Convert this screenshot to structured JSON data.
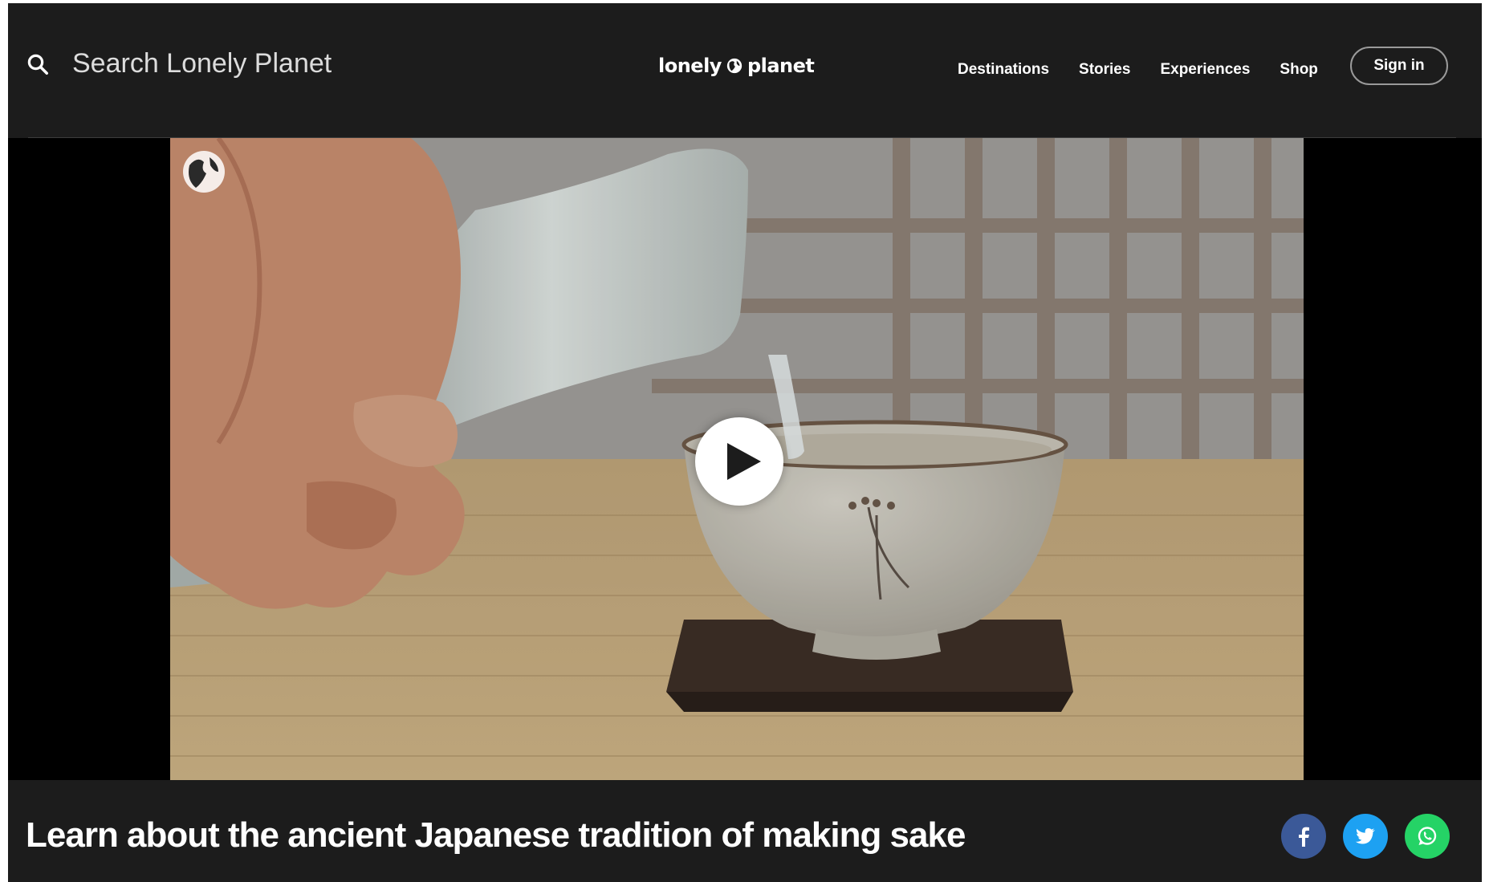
{
  "header": {
    "search_placeholder": "Search Lonely Planet",
    "logo_left": "lonely",
    "logo_right": "planet",
    "nav": [
      "Destinations",
      "Stories",
      "Experiences",
      "Shop"
    ],
    "sign_in": "Sign in"
  },
  "video": {
    "play_icon": "play-icon",
    "watermark_icon": "lonely-planet-globe-icon"
  },
  "article": {
    "title": "Learn about the ancient Japanese tradition of making sake"
  },
  "share": [
    {
      "icon": "facebook-icon",
      "color": "#3b5998"
    },
    {
      "icon": "twitter-icon",
      "color": "#1da1f2"
    },
    {
      "icon": "whatsapp-icon",
      "color": "#25d366"
    }
  ],
  "colors": {
    "header_bg": "#1c1c1c",
    "text": "#ffffff"
  }
}
